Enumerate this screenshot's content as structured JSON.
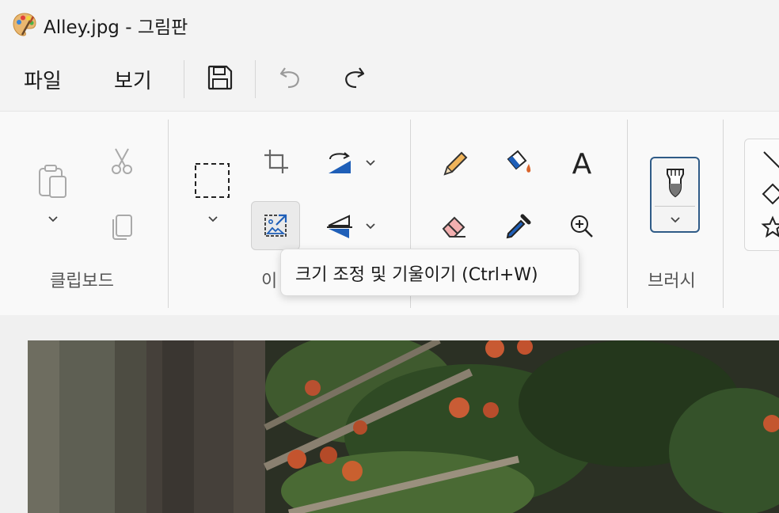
{
  "window": {
    "title": "Alley.jpg - 그림판",
    "app_icon": "paint-palette-icon"
  },
  "menu": {
    "file": "파일",
    "view": "보기",
    "save_icon": "save-icon",
    "undo_icon": "undo-icon",
    "redo_icon": "redo-icon"
  },
  "ribbon": {
    "groups": {
      "clipboard": "클립보드",
      "image": "이",
      "brushes": "브러시"
    },
    "tools": {
      "paste": "paste-icon",
      "cut": "cut-icon",
      "copy": "copy-icon",
      "select": "select-rectangle-icon",
      "crop": "crop-icon",
      "resize": "resize-skew-icon",
      "rotate": "rotate-icon",
      "flip": "flip-icon",
      "pencil": "pencil-icon",
      "fill": "fill-bucket-icon",
      "text": "text-icon",
      "eraser": "eraser-icon",
      "color_picker": "color-picker-icon",
      "magnifier": "magnifier-icon",
      "brush": "brush-icon",
      "shape_line": "line-shape-icon",
      "shape_diamond": "diamond-shape-icon",
      "shape_star": "star-shape-icon"
    },
    "text_glyph": "A"
  },
  "tooltip": {
    "text": "크기 조정 및 기울이기 (Ctrl+W)"
  },
  "colors": {
    "accent_blue": "#1f5fb8",
    "brush_border": "#2f5b87",
    "fill_orange": "#d9632a",
    "eraser_pink": "#f3b0b0",
    "pencil_yellow": "#f0b45a"
  }
}
